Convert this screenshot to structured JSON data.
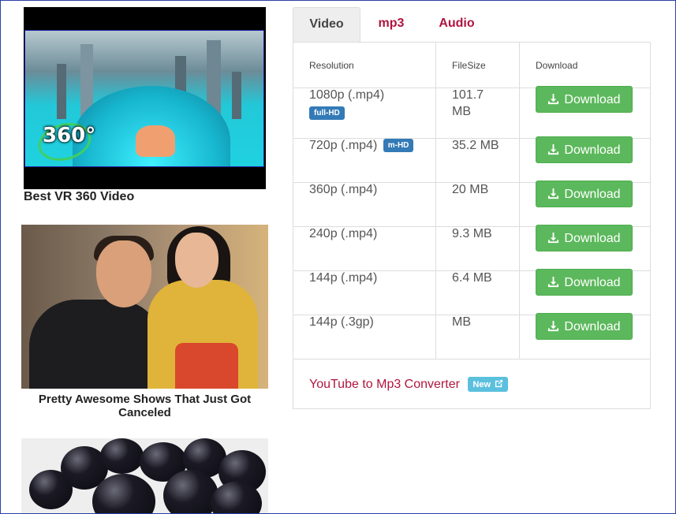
{
  "cards": [
    {
      "title": "Best VR 360 Video",
      "overlay": "360°"
    },
    {
      "title": "Pretty Awesome Shows That Just Got Canceled"
    },
    {
      "title": ""
    }
  ],
  "tabs": [
    {
      "label": "Video",
      "active": true
    },
    {
      "label": "mp3",
      "active": false
    },
    {
      "label": "Audio",
      "active": false
    }
  ],
  "table": {
    "headers": {
      "resolution": "Resolution",
      "filesize": "FileSize",
      "download": "Download"
    },
    "rows": [
      {
        "resolution": "1080p (.mp4)",
        "badge": "full-HD",
        "filesize": "101.7 MB",
        "button": "Download"
      },
      {
        "resolution": "720p (.mp4)",
        "badge": "m-HD",
        "filesize": "35.2 MB",
        "button": "Download"
      },
      {
        "resolution": "360p (.mp4)",
        "badge": "",
        "filesize": "20 MB",
        "button": "Download"
      },
      {
        "resolution": "240p (.mp4)",
        "badge": "",
        "filesize": "9.3 MB",
        "button": "Download"
      },
      {
        "resolution": "144p (.mp4)",
        "badge": "",
        "filesize": "6.4 MB",
        "button": "Download"
      },
      {
        "resolution": "144p (.3gp)",
        "badge": "",
        "filesize": "MB",
        "button": "Download"
      }
    ]
  },
  "footer": {
    "link": "YouTube to Mp3 Converter",
    "badge": "New"
  },
  "colors": {
    "accent": "#b0153f",
    "download_green": "#5cb85c",
    "hd_badge_blue": "#337ab7",
    "new_badge_cyan": "#5bc0de"
  },
  "icons": {
    "download": "download-icon",
    "external": "external-link-icon"
  }
}
